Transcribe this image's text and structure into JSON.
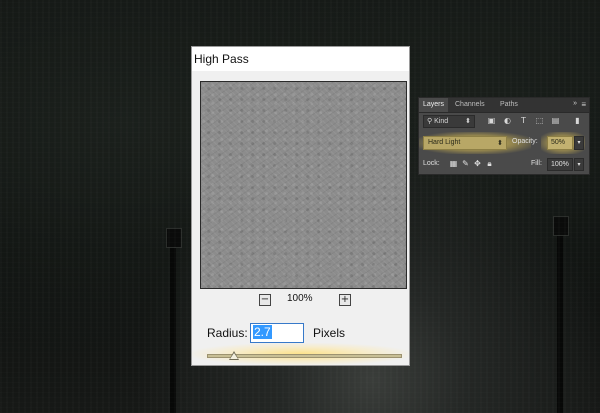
{
  "dialog": {
    "title": "High Pass",
    "zoom_out": "−",
    "zoom_level": "100%",
    "zoom_in": "+",
    "radius_label": "Radius:",
    "radius_value": "2.7",
    "radius_unit": "Pixels",
    "slider_level": 0.14
  },
  "layers_panel": {
    "tabs": [
      "Layers",
      "Channels",
      "Paths"
    ],
    "active_tab": "Layers",
    "collapse_icon": "double-chevron-icon",
    "menu_icon": "panel-menu-icon",
    "kind": {
      "icon": "search-icon",
      "label": "Kind",
      "arrow": "⬍"
    },
    "filter_icons": [
      "pixel-layer-filter-icon",
      "adjustment-layer-filter-icon",
      "type-layer-filter-icon",
      "shape-layer-filter-icon",
      "smart-object-filter-icon"
    ],
    "blend_mode": {
      "label": "Hard Light",
      "arrow": "⬍"
    },
    "opacity": {
      "label": "Opacity:",
      "value": "50%"
    },
    "lock": {
      "label": "Lock:"
    },
    "fill": {
      "label": "Fill:",
      "value": "100%"
    }
  },
  "colors": {
    "highlight": "#e6c85a",
    "selection": "#3399ff"
  }
}
